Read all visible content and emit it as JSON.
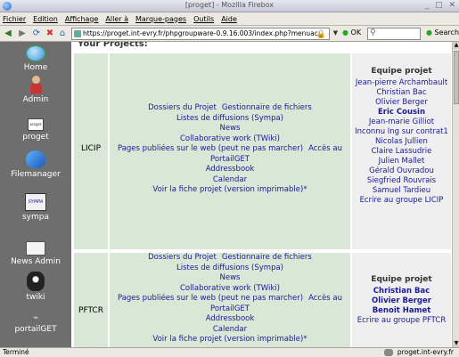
{
  "window": {
    "title": "[proget] - Mozilla Firebox"
  },
  "menubar": [
    "Fichier",
    "Edition",
    "Affichage",
    "Aller à",
    "Marque-pages",
    "Outils",
    "Aide"
  ],
  "navbar": {
    "url": "https://proget.int-evry.fr/phpgroupware-0.9.16.003/index.php?menuac",
    "ok_label": "OK",
    "search_label": "Search"
  },
  "sidebar": {
    "apps": [
      {
        "label": "Home",
        "icon": "globe-icon"
      },
      {
        "label": "Admin",
        "icon": "admin-user-icon"
      },
      {
        "label": "proget",
        "icon": "proget-logo-icon"
      },
      {
        "label": "Filemanager",
        "icon": "filemanager-icon"
      },
      {
        "label": "sympa",
        "icon": "sympa-logo-icon"
      },
      {
        "label": "News Admin",
        "icon": "news-icon"
      },
      {
        "label": "twiki",
        "icon": "twiki-logo-icon"
      },
      {
        "label": "portailGET",
        "icon": "portal-icon"
      }
    ]
  },
  "main": {
    "heading": "Your Projects:",
    "projects": [
      {
        "name": "LICIP",
        "links": {
          "docs": "Dossiers du Projet",
          "files": "Gestionnaire de fichiers",
          "lists": "Listes de diffusions (Sympa)",
          "news": "News",
          "collab": "Collaborative work (TWiki)",
          "pages": "Pages publiées sur le web (peut ne pas marcher)",
          "access": "Accès au PortailGET",
          "addressbook": "Addressbook",
          "calendar": "Calendar",
          "print": "Voir la fiche projet (version imprimable)*"
        },
        "team_title": "Equipe projet",
        "members": [
          "Jean-pierre Archambault",
          "Christian Bac",
          "Olivier Berger",
          "Eric Cousin",
          "Jean-marie Gilliot",
          "Inconnu Ing sur contrat1",
          "Nicolas Jullien",
          "Claire Lassudrie",
          "Julien Mallet",
          "Gérald Ouvradou",
          "Siegfried Rouvrais",
          "Samuel Tardieu"
        ],
        "write": "Ecrire au groupe LICIP"
      },
      {
        "name": "PFTCR",
        "links": {
          "docs": "Dossiers du Projet",
          "files": "Gestionnaire de fichiers",
          "lists": "Listes de diffusions (Sympa)",
          "news": "News",
          "collab": "Collaborative work (TWiki)",
          "pages": "Pages publiées sur le web (peut ne pas marcher)",
          "access": "Accès au PortailGET",
          "addressbook": "Addressbook",
          "calendar": "Calendar",
          "print": "Voir la fiche projet (version imprimable)*"
        },
        "team_title": "Equipe projet",
        "members": [
          "Christian Bac",
          "Olivier Berger",
          "Benoit Hamet"
        ],
        "write": "Ecrire au groupe PFTCR"
      }
    ]
  },
  "status": {
    "text": "Terminé",
    "host": "proget.int-evry.fr"
  }
}
